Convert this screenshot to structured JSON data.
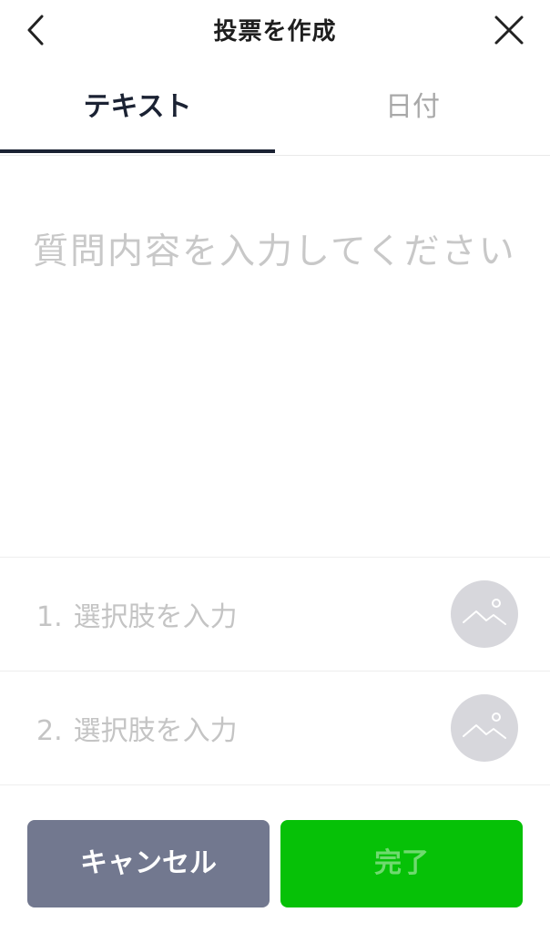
{
  "header": {
    "title": "投票を作成",
    "back_icon": "chevron-left-icon",
    "close_icon": "close-icon"
  },
  "tabs": [
    {
      "label": "テキスト",
      "active": true
    },
    {
      "label": "日付",
      "active": false
    }
  ],
  "question": {
    "placeholder": "質問内容を入力してください",
    "value": ""
  },
  "options": [
    {
      "number": "1.",
      "placeholder": "選択肢を入力",
      "image_icon": "image-icon"
    },
    {
      "number": "2.",
      "placeholder": "選択肢を入力",
      "image_icon": "image-icon"
    }
  ],
  "footer": {
    "cancel_label": "キャンセル",
    "done_label": "完了"
  },
  "colors": {
    "cancel_bg": "#72788f",
    "done_bg": "#06c107",
    "active_tab": "#1b2233"
  }
}
